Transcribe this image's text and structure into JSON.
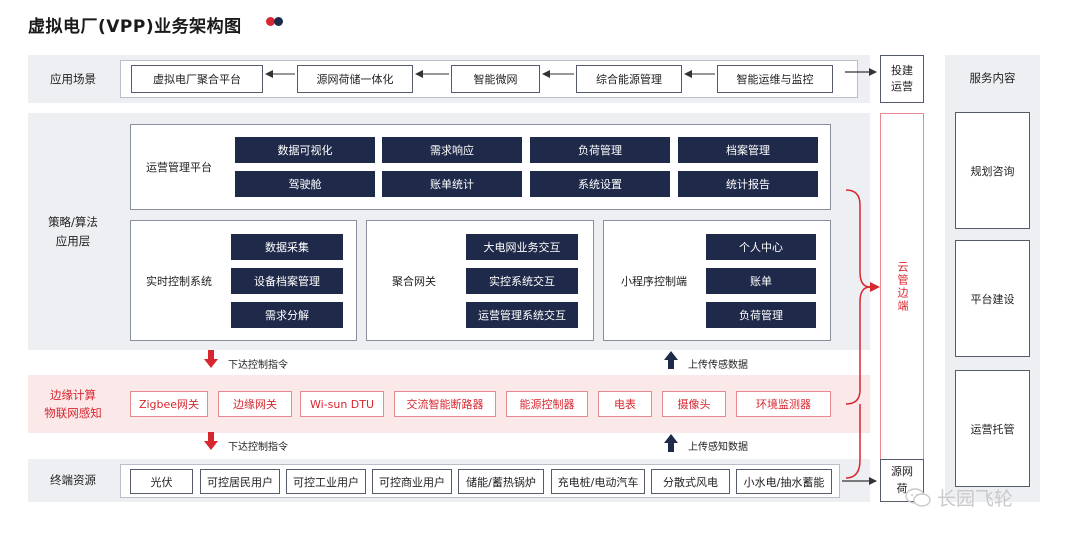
{
  "title": "虚拟电厂(VPP)业务架构图",
  "colors": {
    "navy": "#1f2a4a",
    "red": "#d8262f",
    "band": "#eeeff3",
    "edge_band": "#fbe9ea"
  },
  "layers": {
    "app": "应用场景",
    "strategy": "策略/算法\n应用层",
    "edge": "边缘计算\n物联网感知",
    "terminal": "终端资源"
  },
  "app_scenes": [
    "虚拟电厂聚合平台",
    "源网荷储一体化",
    "智能微网",
    "综合能源管理",
    "智能运维与监控"
  ],
  "ops_platform": {
    "label": "运营管理平台",
    "items": [
      "数据可视化",
      "需求响应",
      "负荷管理",
      "档案管理",
      "驾驶舱",
      "账单统计",
      "系统设置",
      "统计报告"
    ]
  },
  "realtime": {
    "label": "实时控制系统",
    "items": [
      "数据采集",
      "设备档案管理",
      "需求分解"
    ]
  },
  "gateway": {
    "label": "聚合网关",
    "items": [
      "大电网业务交互",
      "实控系统交互",
      "运营管理系统交互"
    ]
  },
  "miniapp": {
    "label": "小程序控制端",
    "items": [
      "个人中心",
      "账单",
      "负荷管理"
    ]
  },
  "flows": {
    "down1": "下达控制指令",
    "up1": "上传传感数据",
    "down2": "下达控制指令",
    "up2": "上传感知数据"
  },
  "edge_devices": [
    "Zigbee网关",
    "边缘网关",
    "Wi-sun DTU",
    "交流智能断路器",
    "能源控制器",
    "电表",
    "摄像头",
    "环境监测器"
  ],
  "terminals": [
    "光伏",
    "可控居民用户",
    "可控工业用户",
    "可控商业用户",
    "储能/蓄热锅炉",
    "充电桩/电动汽车",
    "分散式风电",
    "小水电/抽水蓄能"
  ],
  "side": {
    "invest": "投建\n运营",
    "cloud": "云管边端",
    "source_grid": "源网\n荷"
  },
  "services": {
    "title": "服务内容",
    "items": [
      "规划咨询",
      "平台建设",
      "运营托管"
    ]
  },
  "watermark": "长园飞轮"
}
